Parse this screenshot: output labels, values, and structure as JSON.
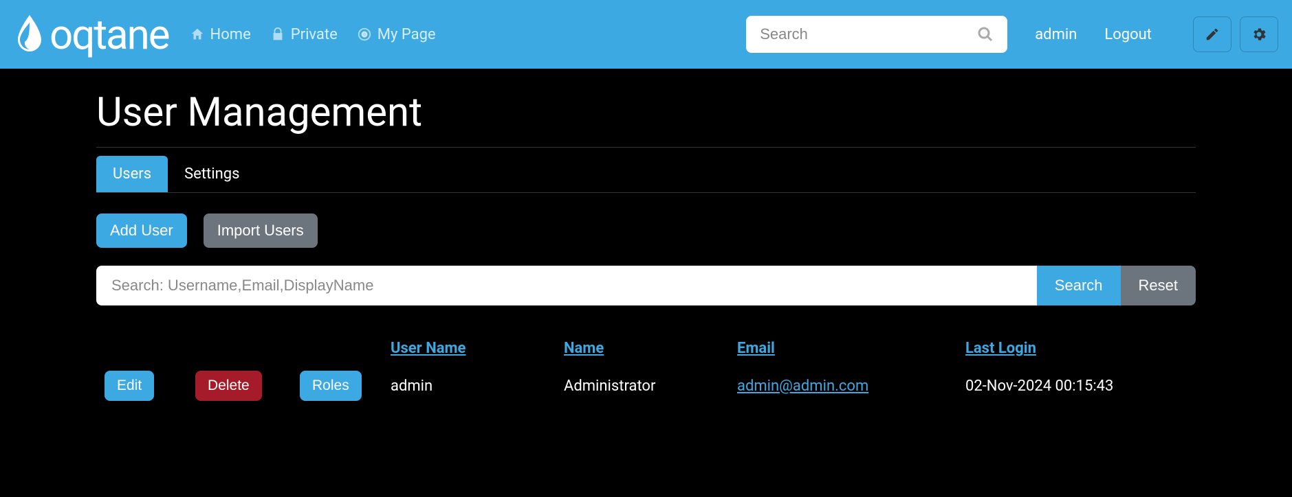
{
  "brand": "oqtane",
  "nav": {
    "items": [
      {
        "label": "Home",
        "icon": "home"
      },
      {
        "label": "Private",
        "icon": "lock"
      },
      {
        "label": "My Page",
        "icon": "target"
      }
    ]
  },
  "search": {
    "placeholder": "Search"
  },
  "user": {
    "name": "admin",
    "logout_label": "Logout"
  },
  "page": {
    "title": "User Management",
    "tabs": [
      {
        "label": "Users",
        "active": true
      },
      {
        "label": "Settings",
        "active": false
      }
    ],
    "actions": {
      "add_user": "Add User",
      "import_users": "Import Users"
    },
    "user_search": {
      "placeholder": "Search: Username,Email,DisplayName",
      "search_label": "Search",
      "reset_label": "Reset"
    },
    "table": {
      "columns": {
        "username": "User Name",
        "name": "Name",
        "email": "Email",
        "last_login": "Last Login"
      },
      "row_buttons": {
        "edit": "Edit",
        "delete": "Delete",
        "roles": "Roles"
      },
      "rows": [
        {
          "username": "admin",
          "name": "Administrator",
          "email": "admin@admin.com",
          "last_login": "02-Nov-2024 00:15:43"
        }
      ]
    }
  },
  "colors": {
    "accent": "#3ca9e2",
    "danger": "#a61b29",
    "secondary": "#6c757d"
  }
}
